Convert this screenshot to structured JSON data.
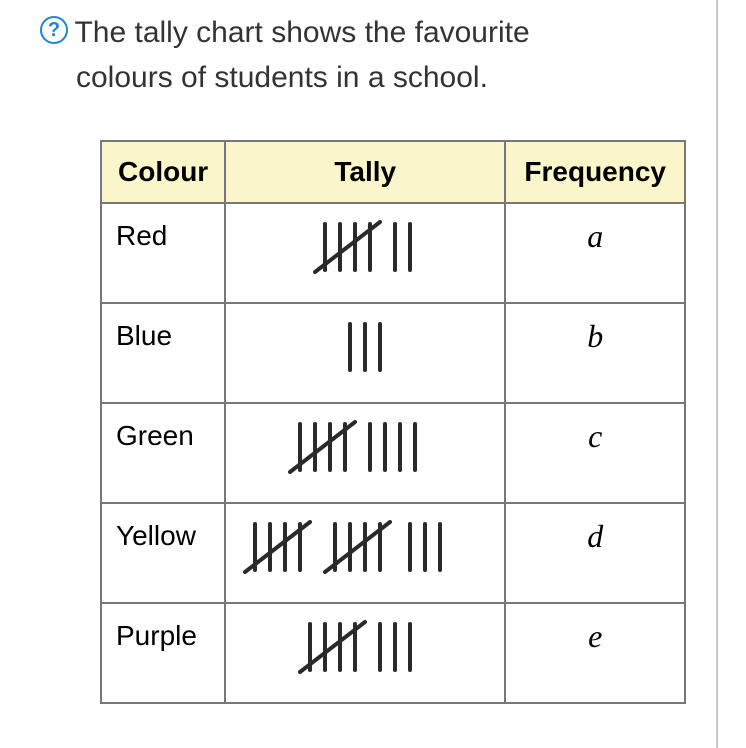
{
  "question": {
    "line1": "The tally chart shows the favourite",
    "line2": "colours of students in a school."
  },
  "table": {
    "headers": {
      "colour": "Colour",
      "tally": "Tally",
      "frequency": "Frequency"
    },
    "rows": [
      {
        "colour": "Red",
        "frequency": "a"
      },
      {
        "colour": "Blue",
        "frequency": "b"
      },
      {
        "colour": "Green",
        "frequency": "c"
      },
      {
        "colour": "Yellow",
        "frequency": "d"
      },
      {
        "colour": "Purple",
        "frequency": "e"
      }
    ]
  },
  "chart_data": {
    "type": "table",
    "title": "Favourite colours of students",
    "categories": [
      "Red",
      "Blue",
      "Green",
      "Yellow",
      "Purple"
    ],
    "values": [
      7,
      3,
      9,
      13,
      8
    ],
    "frequency_placeholders": [
      "a",
      "b",
      "c",
      "d",
      "e"
    ]
  }
}
